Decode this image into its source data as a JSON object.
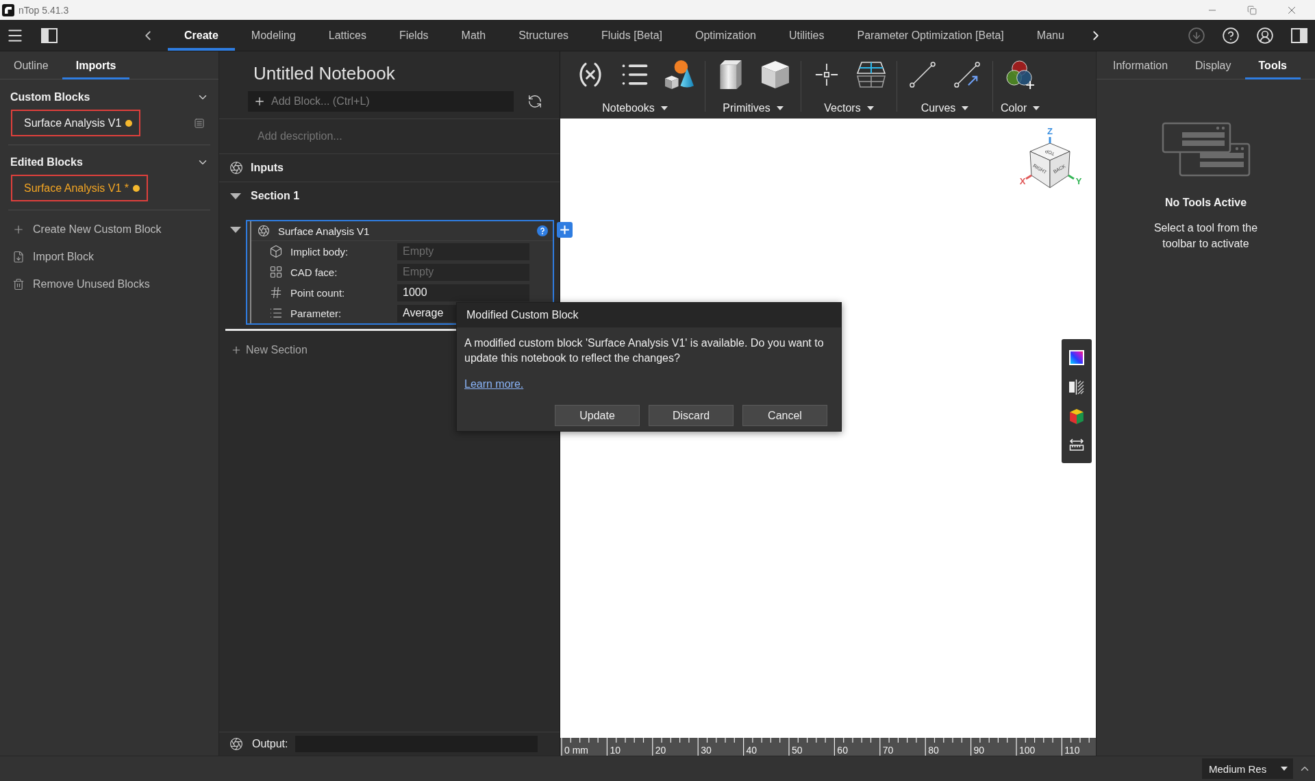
{
  "window": {
    "title": "nTop 5.41.3"
  },
  "menu_bar": {
    "tabs": [
      {
        "label": "Create",
        "selected": true
      },
      {
        "label": "Modeling",
        "selected": false
      },
      {
        "label": "Lattices",
        "selected": false
      },
      {
        "label": "Fields",
        "selected": false
      },
      {
        "label": "Math",
        "selected": false
      },
      {
        "label": "Structures",
        "selected": false
      },
      {
        "label": "Fluids [Beta]",
        "selected": false
      },
      {
        "label": "Optimization",
        "selected": false
      },
      {
        "label": "Utilities",
        "selected": false
      },
      {
        "label": "Parameter Optimization [Beta]",
        "selected": false
      },
      {
        "label": "Manu",
        "selected": false
      }
    ],
    "download": {
      "disabled": true
    }
  },
  "left_panel": {
    "tabs": [
      {
        "label": "Outline",
        "selected": false
      },
      {
        "label": "Imports",
        "selected": true
      }
    ],
    "groups": [
      {
        "title": "Custom Blocks",
        "kind": "library",
        "expanded": true,
        "items": [
          {
            "label": "Surface Analysis V1",
            "edited": false,
            "modified": true,
            "highlighted": true
          }
        ]
      },
      {
        "title": "Edited Blocks",
        "kind": "edited",
        "expanded": true,
        "items": [
          {
            "label": "Surface Analysis V1 *",
            "edited": true,
            "modified": true,
            "highlighted": true
          }
        ]
      }
    ],
    "actions": [
      {
        "label": "Create New Custom Block",
        "kind": "create"
      },
      {
        "label": "Import Block",
        "kind": "import"
      },
      {
        "label": "Remove Unused Blocks",
        "kind": "remove"
      }
    ]
  },
  "notebook": {
    "title": "Untitled Notebook",
    "add_block": {
      "placeholder": "Add Block... (Ctrl+L)"
    },
    "description": {
      "placeholder": "Add description..."
    },
    "inputs": {
      "label": "Inputs"
    },
    "sections": [
      {
        "title": "Section 1",
        "expanded": true,
        "blocks": [
          {
            "title": "Surface Analysis V1",
            "expanded": true,
            "selected": true,
            "parameters": [
              {
                "label": "Implict body:",
                "kind": "body",
                "placeholder": "Empty"
              },
              {
                "label": "CAD face:",
                "kind": "face",
                "placeholder": "Empty"
              },
              {
                "label": "Point count:",
                "kind": "number",
                "value": "1000"
              },
              {
                "label": "Parameter:",
                "kind": "enum",
                "value": "Average"
              }
            ]
          }
        ]
      }
    ],
    "new_section": {
      "label": "New Section"
    },
    "output": {
      "label": "Output:"
    }
  },
  "toolbar": {
    "groups": [
      {
        "label": "Notebooks",
        "kind": "notebooks"
      },
      {
        "label": "Primitives",
        "kind": "primitives"
      },
      {
        "label": "Vectors",
        "kind": "vectors"
      },
      {
        "label": "Curves",
        "kind": "curves"
      },
      {
        "label": "Color",
        "kind": "color"
      }
    ]
  },
  "viewport": {
    "view_cube": {
      "axes": [
        {
          "label": "X",
          "color": "#e05a5a"
        },
        {
          "label": "Y",
          "color": "#34b556"
        },
        {
          "label": "Z",
          "color": "#3a8fe0"
        }
      ],
      "faces": [
        "TOP",
        "RIGHT",
        "BACK"
      ]
    },
    "ruler": {
      "labels": [
        "0 mm",
        "10",
        "20",
        "30",
        "40",
        "50",
        "60",
        "70",
        "80",
        "90",
        "100",
        "110"
      ]
    }
  },
  "right_panel": {
    "tabs": [
      {
        "label": "Information",
        "selected": false
      },
      {
        "label": "Display",
        "selected": false
      },
      {
        "label": "Tools",
        "selected": true
      }
    ],
    "empty_state": {
      "title": "No Tools Active",
      "message": "Select a tool from the toolbar to activate"
    }
  },
  "dialog": {
    "title": "Modified Custom Block",
    "message": "A modified custom block 'Surface Analysis V1' is available. Do you want to update this notebook to reflect the changes?",
    "link": "Learn more.",
    "buttons": [
      "Update",
      "Discard",
      "Cancel"
    ]
  },
  "status_bar": {
    "resolution": {
      "value": "Medium Res"
    }
  }
}
